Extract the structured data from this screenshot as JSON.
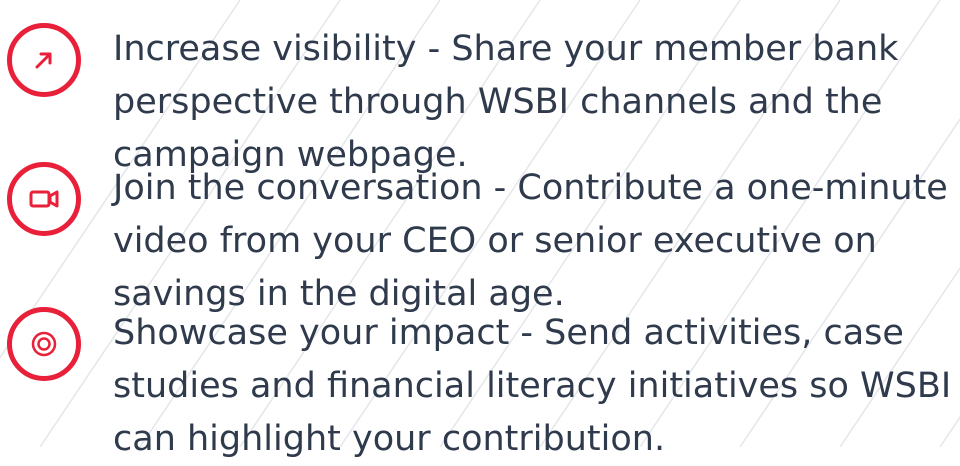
{
  "colors": {
    "accent": "#e8203a",
    "text": "#2f3a4c",
    "background": "#ffffff",
    "pattern_lines": "#e4e6ea"
  },
  "items": [
    {
      "icon": "arrow-up-right-icon",
      "lines": [
        "Increase visibility - Share your member bank",
        "perspective through WSBI channels and the",
        "campaign webpage."
      ]
    },
    {
      "icon": "video-camera-icon",
      "lines": [
        "Join the conversation - Contribute a one-minute",
        "video from your CEO or senior executive on",
        "savings in the digital age."
      ]
    },
    {
      "icon": "target-icon",
      "lines": [
        "Showcase your impact - Send activities, case",
        "studies and financial literacy initiatives so WSBI",
        "can highlight your contribution."
      ]
    }
  ]
}
